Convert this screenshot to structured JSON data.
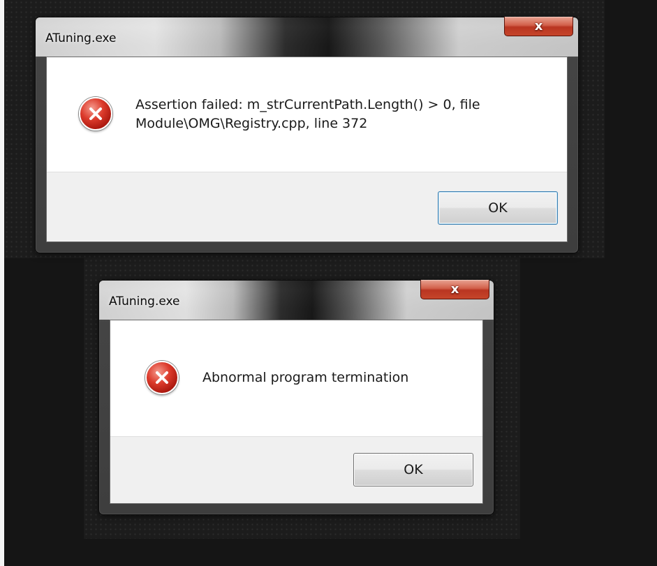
{
  "dialogs": [
    {
      "title": "ATuning.exe",
      "close_label": "x",
      "icon": "error-icon",
      "message_lines": [
        "Assertion failed: m_strCurrentPath.Length() > 0, file",
        "Module\\OMG\\Registry.cpp, line 372"
      ],
      "ok_label": "OK"
    },
    {
      "title": "ATuning.exe",
      "close_label": "x",
      "icon": "error-icon",
      "message_lines": [
        "Abnormal program termination"
      ],
      "ok_label": "OK"
    }
  ],
  "colors": {
    "close_button": "#c7452a",
    "error_icon": "#d2372a",
    "desktop": "#151515",
    "footer": "#f0f0f0"
  }
}
